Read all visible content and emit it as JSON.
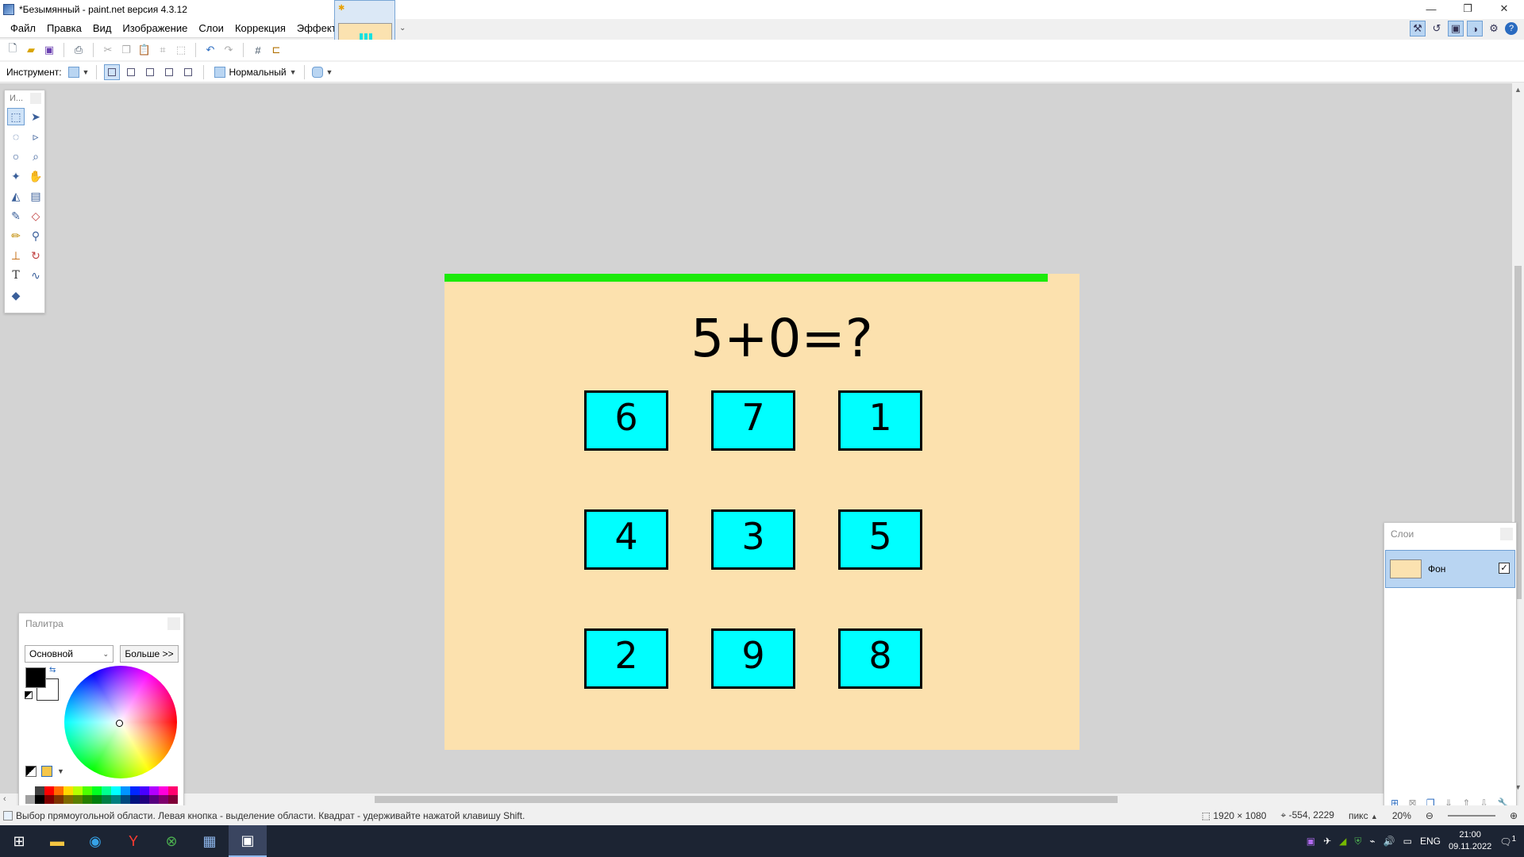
{
  "window": {
    "title": "*Безымянный - paint.net версия 4.3.12",
    "controls": [
      "—",
      "❐",
      "✕"
    ]
  },
  "menu": [
    "Файл",
    "Правка",
    "Вид",
    "Изображение",
    "Слои",
    "Коррекция",
    "Эффекты"
  ],
  "toolbar2": {
    "tool_label": "Инструмент:",
    "blend_mode": "Нормальный"
  },
  "tools_window": {
    "title": "И..."
  },
  "canvas": {
    "background": "#fce1ae",
    "progress_color": "#1bea0a",
    "progress_fraction": 0.95,
    "question": "5+0=?",
    "answers": [
      "6",
      "7",
      "1",
      "4",
      "3",
      "5",
      "2",
      "9",
      "8"
    ],
    "answer_color": "#00ffff"
  },
  "palette_window": {
    "title": "Палитра",
    "palette_name": "Основной",
    "more_button": "Больше >>",
    "primary_color": "#000000",
    "secondary_color": "#ffffff",
    "swatches": [
      "#ffffff",
      "#404040",
      "#ff0000",
      "#ff6a00",
      "#ffd800",
      "#b6ff00",
      "#4cff00",
      "#00ff21",
      "#00ff90",
      "#00ffff",
      "#0094ff",
      "#0026ff",
      "#4800ff",
      "#b200ff",
      "#ff00dc",
      "#ff006e",
      "#a0a0a0",
      "#000000",
      "#7f0000",
      "#7f3300",
      "#7f6a00",
      "#5b7f00",
      "#267f00",
      "#007f0e",
      "#007f46",
      "#007f7f",
      "#004a7f",
      "#00137f",
      "#21007f",
      "#57007f",
      "#7f006e",
      "#7f0037"
    ]
  },
  "layers_window": {
    "title": "Слои",
    "layer_name": "Фон",
    "layer_visible_mark": "✓"
  },
  "status": {
    "message": "Выбор прямоугольной области. Левая кнопка - выделение области. Квадрат - удерживайте нажатой клавишу Shift.",
    "image_size": "1920 × 1080",
    "cursor_pos": "-554, 2229",
    "units": "пикс",
    "zoom": "20%"
  },
  "taskbar": {
    "language": "ENG",
    "time": "21:00",
    "date": "09.11.2022",
    "notifications": "1"
  }
}
